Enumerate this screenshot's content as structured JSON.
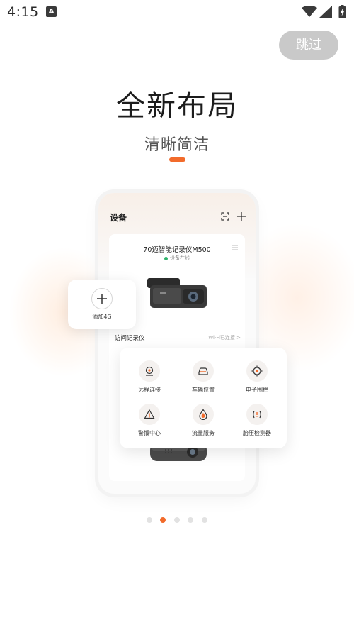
{
  "status_bar": {
    "time": "4:15",
    "app_icon_letter": "A"
  },
  "skip_button": {
    "label": "跳过"
  },
  "headline": "全新布局",
  "subheadline": "清晰简洁",
  "colors": {
    "accent": "#f26b2b",
    "skip_bg": "#c9c9c9",
    "online": "#2fb36b"
  },
  "phone": {
    "title": "设备",
    "device_card": {
      "name": "70迈智能记录仪M500",
      "status": "设备在线",
      "access_label": "访问记录仪",
      "wifi_status": "Wi-Fi已连接 >"
    }
  },
  "add_4g": {
    "label": "添加4G"
  },
  "functions": [
    {
      "label": "远程连接",
      "icon": "camera-icon"
    },
    {
      "label": "车辆位置",
      "icon": "car-icon"
    },
    {
      "label": "电子围栏",
      "icon": "target-icon"
    },
    {
      "label": "警报中心",
      "icon": "warning-icon"
    },
    {
      "label": "流量服务",
      "icon": "drop-icon"
    },
    {
      "label": "胎压检测器",
      "icon": "tire-pressure-icon"
    }
  ],
  "pagination": {
    "total": 5,
    "active_index": 1
  }
}
